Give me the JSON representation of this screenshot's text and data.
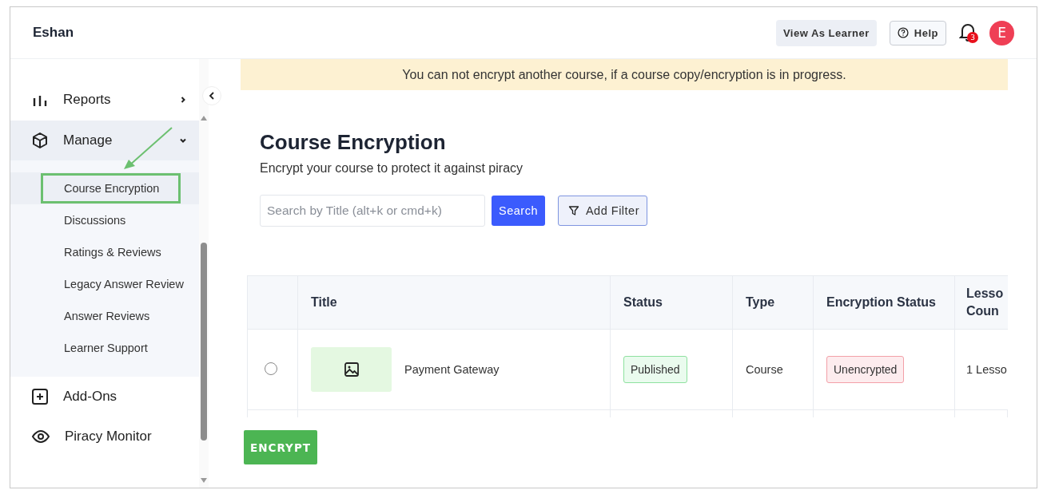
{
  "header": {
    "brand": "Eshan",
    "view_as_learner": "View As Learner",
    "help": "Help",
    "notification_count": "3",
    "avatar_initial": "E"
  },
  "sidebar": {
    "items": [
      {
        "label": "Reports",
        "kind": "group",
        "expanded": false
      },
      {
        "label": "Manage",
        "kind": "group",
        "expanded": true,
        "children": [
          {
            "label": "Course Encryption",
            "selected": true,
            "annotated": true
          },
          {
            "label": "Discussions",
            "selected": false,
            "annotated": false
          },
          {
            "label": "Ratings & Reviews",
            "selected": false,
            "annotated": false
          },
          {
            "label": "Legacy Answer Review",
            "selected": false,
            "annotated": false
          },
          {
            "label": "Answer Reviews",
            "selected": false,
            "annotated": false
          },
          {
            "label": "Learner Support",
            "selected": false,
            "annotated": false
          }
        ]
      },
      {
        "label": "Add-Ons",
        "kind": "link"
      },
      {
        "label": "Piracy Monitor",
        "kind": "link"
      }
    ]
  },
  "banner": "You can not encrypt another course, if a course copy/encryption is in progress.",
  "page": {
    "title": "Course Encryption",
    "subtitle": "Encrypt your course to protect it against piracy",
    "search": {
      "placeholder": "Search by Title (alt+k or cmd+k)"
    },
    "search_button": "Search",
    "filter_button": "Add Filter"
  },
  "table": {
    "columns": [
      "Title",
      "Status",
      "Type",
      "Encryption Status",
      "Lesso\nCoun"
    ],
    "rows": [
      {
        "selected": false,
        "title": "Payment Gateway",
        "status": "Published",
        "type": "Course",
        "encryption_status": "Unencrypted",
        "column_6": "1 Lesso"
      }
    ]
  },
  "encrypt_button": "ENCRYPT"
}
